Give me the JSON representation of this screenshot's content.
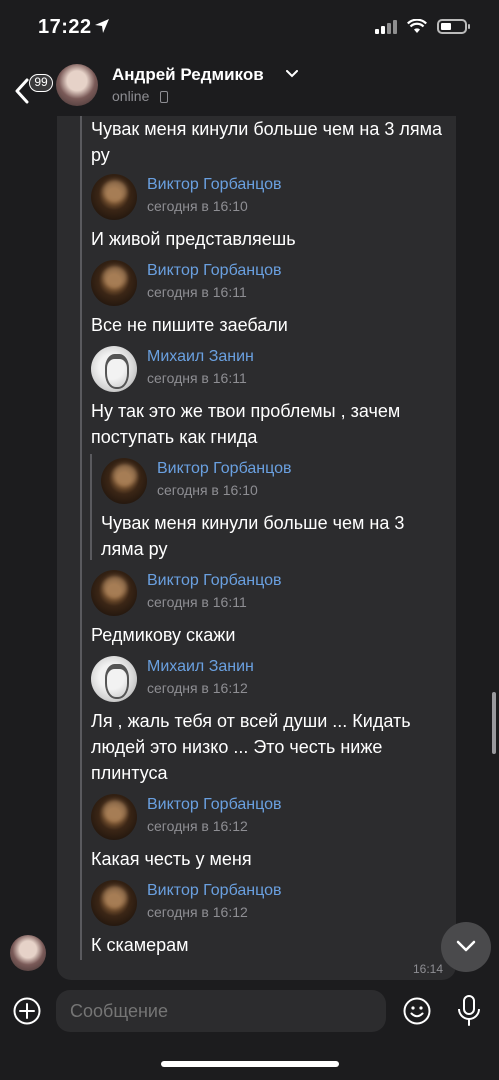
{
  "status_bar": {
    "time": "17:22"
  },
  "header": {
    "back_badge": "99",
    "name": "Андрей Редмиков",
    "status": "online"
  },
  "messages": {
    "quote_top_text": "Чувак меня кинули больше чем на 3 ляма ру",
    "items": [
      {
        "author": "Виктор Горбанцов",
        "date": "сегодня в 16:10",
        "text": "И живой представляешь"
      },
      {
        "author": "Виктор Горбанцов",
        "date": "сегодня в 16:11",
        "text": "Все не пишите заебали"
      },
      {
        "author": "Михаил Занин",
        "date": "сегодня в 16:11",
        "text": "Ну так это же твои проблемы , зачем поступать как гнида"
      },
      {
        "author": "Виктор Горбанцов",
        "date": "сегодня в 16:10",
        "text": "Чувак меня кинули больше чем на 3 ляма ру"
      },
      {
        "author": "Виктор Горбанцов",
        "date": "сегодня в 16:11",
        "text": "Редмикову скажи"
      },
      {
        "author": "Михаил Занин",
        "date": "сегодня в 16:12",
        "text": "Ля , жаль тебя от всей души ... Кидать людей это низко ... Это честь ниже плинтуса"
      },
      {
        "author": "Виктор Горбанцов",
        "date": "сегодня в 16:12",
        "text": "Какая честь у меня"
      },
      {
        "author": "Виктор Горбанцов",
        "date": "сегодня в 16:12",
        "text": "К скамерам"
      }
    ],
    "time": "16:14"
  },
  "composer": {
    "placeholder": "Сообщение"
  },
  "colors": {
    "accent": "#6aa0e0",
    "bubble": "#2c2c2e",
    "background": "#1c1c1e"
  },
  "icons": [
    "location-arrow-icon",
    "signal-icon",
    "wifi-icon",
    "battery-icon",
    "back-icon",
    "chevron-down-icon",
    "phone-icon",
    "plus-icon",
    "emoji-icon",
    "mic-icon",
    "arrow-down-icon"
  ]
}
